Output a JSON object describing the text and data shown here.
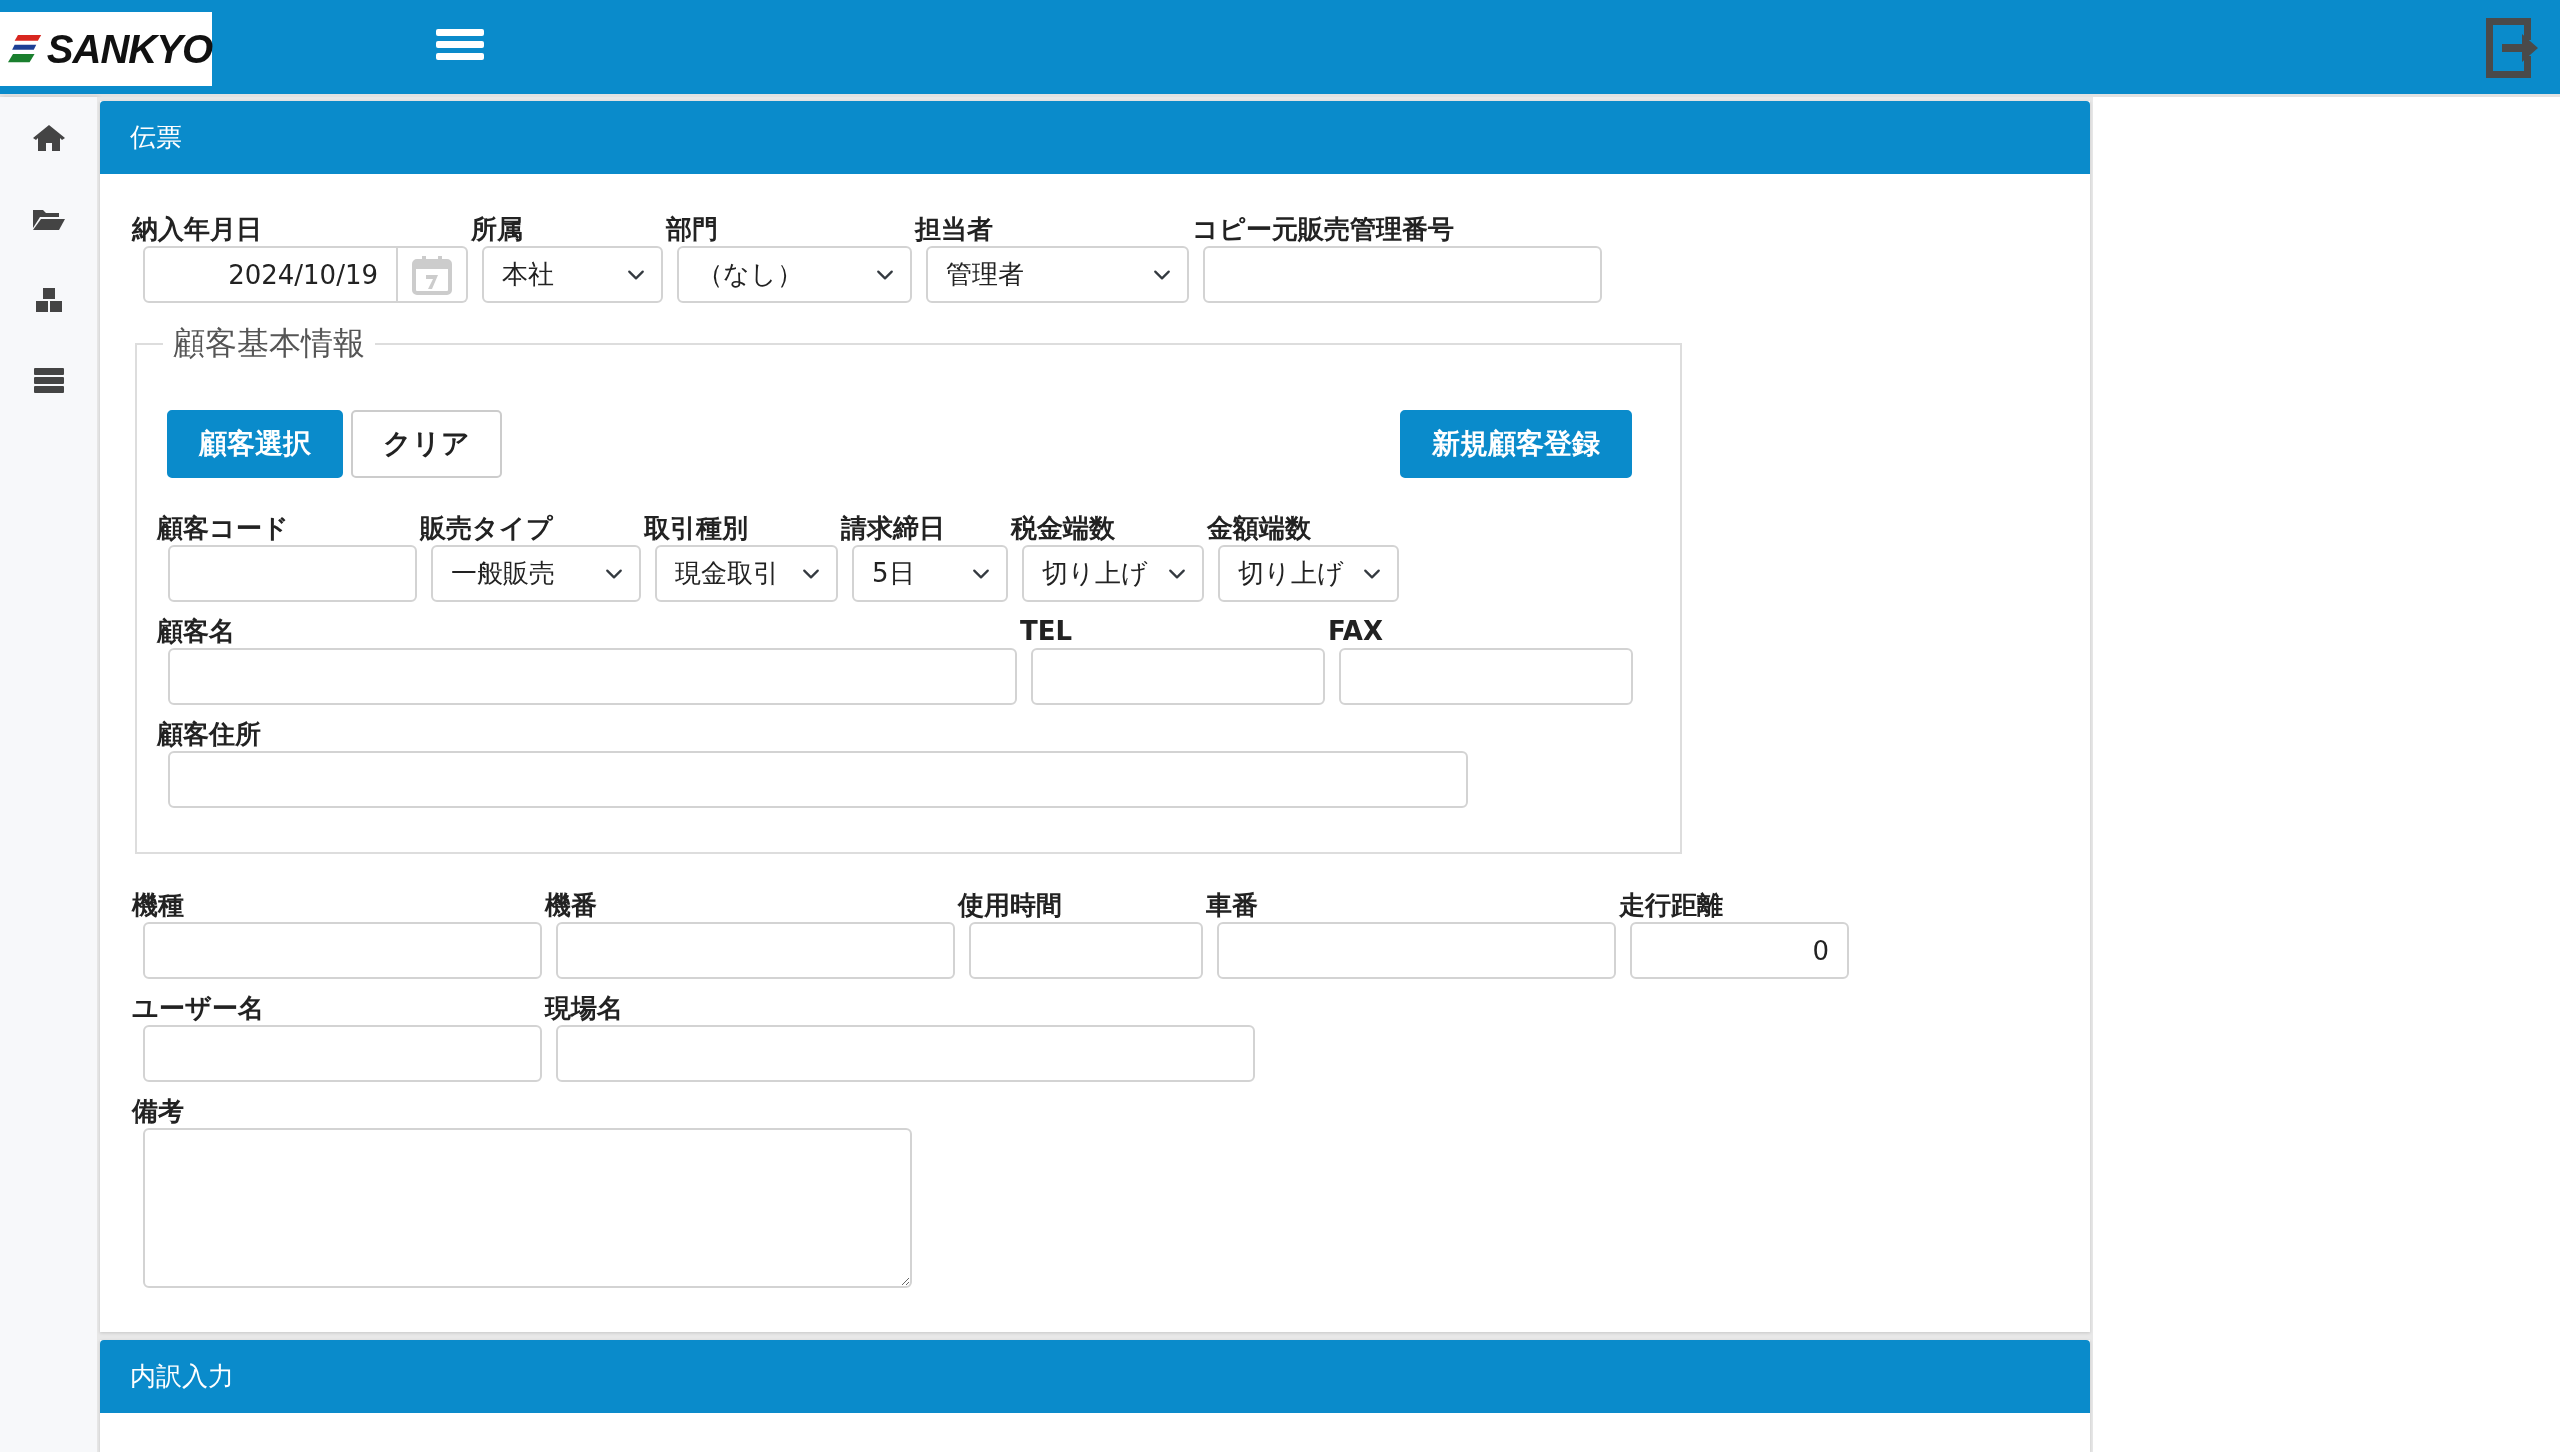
{
  "header": {
    "logo": "SANKYO"
  },
  "sections": [
    {
      "title": "伝票"
    },
    {
      "title": "内訳入力"
    }
  ],
  "slip": {
    "rows": [
      {
        "fields": [
          {
            "label": "納入年月日",
            "kind": "date",
            "value": "2024/10/19"
          },
          {
            "label": "所属",
            "kind": "select",
            "value": "本社"
          },
          {
            "label": "部門",
            "kind": "select",
            "value": "（なし）"
          },
          {
            "label": "担当者",
            "kind": "select",
            "value": "管理者"
          },
          {
            "label": "コピー元販売管理番号",
            "kind": "text"
          }
        ]
      }
    ],
    "customer": {
      "legend": "顧客基本情報",
      "left_buttons": [
        {
          "label": "顧客選択",
          "kind": "primary"
        },
        {
          "label": "クリア",
          "kind": "outline"
        }
      ],
      "right_buttons": [
        {
          "label": "新規顧客登録",
          "kind": "primary"
        }
      ],
      "rows": [
        {
          "fields": [
            {
              "label": "顧客コード",
              "kind": "text"
            },
            {
              "label": "販売タイプ",
              "kind": "select",
              "value": "一般販売"
            },
            {
              "label": "取引種別",
              "kind": "select",
              "value": "現金取引"
            },
            {
              "label": "請求締日",
              "kind": "select",
              "value": "5日"
            },
            {
              "label": "税金端数",
              "kind": "select",
              "value": "切り上げ"
            },
            {
              "label": "金額端数",
              "kind": "select",
              "value": "切り上げ"
            }
          ]
        },
        {
          "fields": [
            {
              "label": "顧客名",
              "kind": "text"
            },
            {
              "label": "TEL",
              "kind": "text"
            },
            {
              "label": "FAX",
              "kind": "text"
            }
          ]
        },
        {
          "fields": [
            {
              "label": "顧客住所",
              "kind": "text"
            }
          ]
        }
      ]
    },
    "machine_rows": [
      {
        "fields": [
          {
            "label": "機種",
            "kind": "text"
          },
          {
            "label": "機番",
            "kind": "text"
          },
          {
            "label": "使用時間",
            "kind": "text"
          },
          {
            "label": "車番",
            "kind": "text"
          },
          {
            "label": "走行距離",
            "kind": "number",
            "value": "0"
          }
        ]
      },
      {
        "fields": [
          {
            "label": "ユーザー名",
            "kind": "text"
          },
          {
            "label": "現場名",
            "kind": "text"
          }
        ]
      },
      {
        "fields": [
          {
            "label": "備考",
            "kind": "textarea"
          }
        ]
      }
    ]
  }
}
